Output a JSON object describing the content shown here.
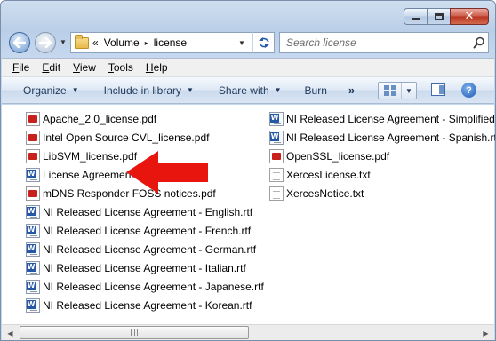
{
  "window": {
    "minimize_icon": "minimize-icon",
    "maximize_icon": "maximize-icon",
    "close_icon": "close-icon",
    "close_glyph": "✕"
  },
  "address_bar": {
    "overflow": "«",
    "crumbs": [
      "Volume",
      "license"
    ],
    "separator": "▸",
    "dropdown": "▼"
  },
  "search": {
    "placeholder": "Search license"
  },
  "menu": {
    "file": {
      "underline": "F",
      "rest": "ile"
    },
    "edit": {
      "underline": "E",
      "rest": "dit"
    },
    "view": {
      "underline": "V",
      "rest": "iew"
    },
    "tools": {
      "underline": "T",
      "rest": "ools"
    },
    "help": {
      "underline": "H",
      "rest": "elp"
    }
  },
  "toolbar": {
    "organize": "Organize",
    "include": "Include in library",
    "share": "Share with",
    "burn": "Burn",
    "more": "»",
    "caret": "▼",
    "help": "?"
  },
  "files": {
    "col1": [
      {
        "name": "Apache_2.0_license.pdf",
        "type": "pdf"
      },
      {
        "name": "Intel Open Source CVL_license.pdf",
        "type": "pdf"
      },
      {
        "name": "LibSVM_license.pdf",
        "type": "pdf"
      },
      {
        "name": "License Agreement.rtf",
        "type": "rtf"
      },
      {
        "name": "mDNS Responder FOSS notices.pdf",
        "type": "pdf"
      },
      {
        "name": "NI Released License Agreement - English.rtf",
        "type": "rtf"
      },
      {
        "name": "NI Released License Agreement - French.rtf",
        "type": "rtf"
      },
      {
        "name": "NI Released License Agreement - German.rtf",
        "type": "rtf"
      },
      {
        "name": "NI Released License Agreement - Italian.rtf",
        "type": "rtf"
      },
      {
        "name": "NI Released License Agreement - Japanese.rtf",
        "type": "rtf"
      },
      {
        "name": "NI Released License Agreement - Korean.rtf",
        "type": "rtf"
      }
    ],
    "col2": [
      {
        "name": "NI Released License Agreement - Simplified",
        "type": "rtf"
      },
      {
        "name": "NI Released License Agreement - Spanish.rtf",
        "type": "rtf"
      },
      {
        "name": "OpenSSL_license.pdf",
        "type": "pdf"
      },
      {
        "name": "XercesLicense.txt",
        "type": "txt"
      },
      {
        "name": "XercesNotice.txt",
        "type": "txt"
      }
    ]
  },
  "colors": {
    "arrow": "#e8150f",
    "pdf_icon": "#c8201b",
    "rtf_icon": "#2457a6"
  }
}
